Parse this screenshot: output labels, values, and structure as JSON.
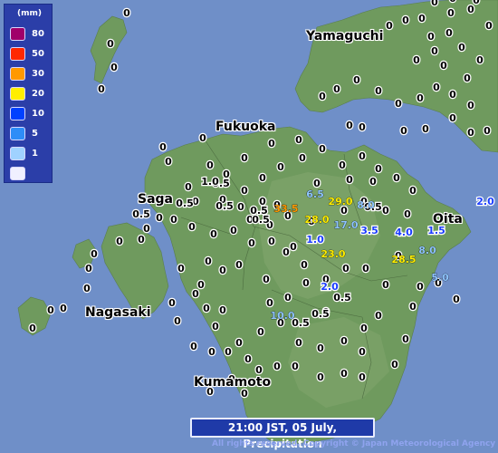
{
  "legend": {
    "unit": "(mm)",
    "entries": [
      {
        "label": "80",
        "color": "#a0006a"
      },
      {
        "label": "50",
        "color": "#ff2800"
      },
      {
        "label": "30",
        "color": "#ff9900"
      },
      {
        "label": "20",
        "color": "#ffee00"
      },
      {
        "label": "10",
        "color": "#0041ff"
      },
      {
        "label": "5",
        "color": "#2e8df7"
      },
      {
        "label": "1",
        "color": "#a0d2ff"
      },
      {
        "label": "",
        "color": "#f0f0ff"
      }
    ]
  },
  "places": {
    "yamaguchi": "Yamaguchi",
    "fukuoka": "Fukuoka",
    "saga": "Saga",
    "oita": "Oita",
    "nagasaki": "Nagasaki",
    "kumamoto": "Kumamoto"
  },
  "title": "21:00 JST, 05 July, Precipitation",
  "copyright": "All rights reserved. Copyright © Japan Meteorological Agency",
  "colors": {
    "sea": "#6f8fc8",
    "land": "#6f9a5e",
    "land_high": "#84a870",
    "zero": "#000000",
    "light": "#8fc5ff",
    "mid": "#1a3cff",
    "yellow": "#ffee00",
    "orange": "#ff9900"
  },
  "observations": {
    "zero_label": "0",
    "values": [
      {
        "v": "0.5",
        "c": "zero"
      },
      {
        "v": "0.5",
        "c": "zero"
      },
      {
        "v": "0.5",
        "c": "zero"
      },
      {
        "v": "0.5",
        "c": "zero"
      },
      {
        "v": "0.5",
        "c": "zero"
      },
      {
        "v": "0.5",
        "c": "zero"
      },
      {
        "v": "0.5",
        "c": "zero"
      },
      {
        "v": "0.5",
        "c": "zero"
      },
      {
        "v": "0.5",
        "c": "zero"
      },
      {
        "v": "6.5",
        "c": "light"
      },
      {
        "v": "8.0",
        "c": "light"
      },
      {
        "v": "8.0",
        "c": "light"
      },
      {
        "v": "5.0",
        "c": "light"
      },
      {
        "v": "10.0",
        "c": "light"
      },
      {
        "v": "17.0",
        "c": "light"
      },
      {
        "v": "29.0",
        "c": "yellow"
      },
      {
        "v": "28.0",
        "c": "yellow"
      },
      {
        "v": "23.0",
        "c": "yellow"
      },
      {
        "v": "28.5",
        "c": "yellow"
      },
      {
        "v": "33.5",
        "c": "orange"
      },
      {
        "v": "1.0",
        "c": "mid"
      },
      {
        "v": "2.0",
        "c": "mid"
      },
      {
        "v": "3.5",
        "c": "mid"
      },
      {
        "v": "4.0",
        "c": "mid"
      },
      {
        "v": "1.5",
        "c": "mid"
      },
      {
        "v": "2.0",
        "c": "mid"
      },
      {
        "v": "1.0",
        "c": "zero"
      },
      {
        "v": "0.5",
        "c": "zero"
      }
    ]
  }
}
